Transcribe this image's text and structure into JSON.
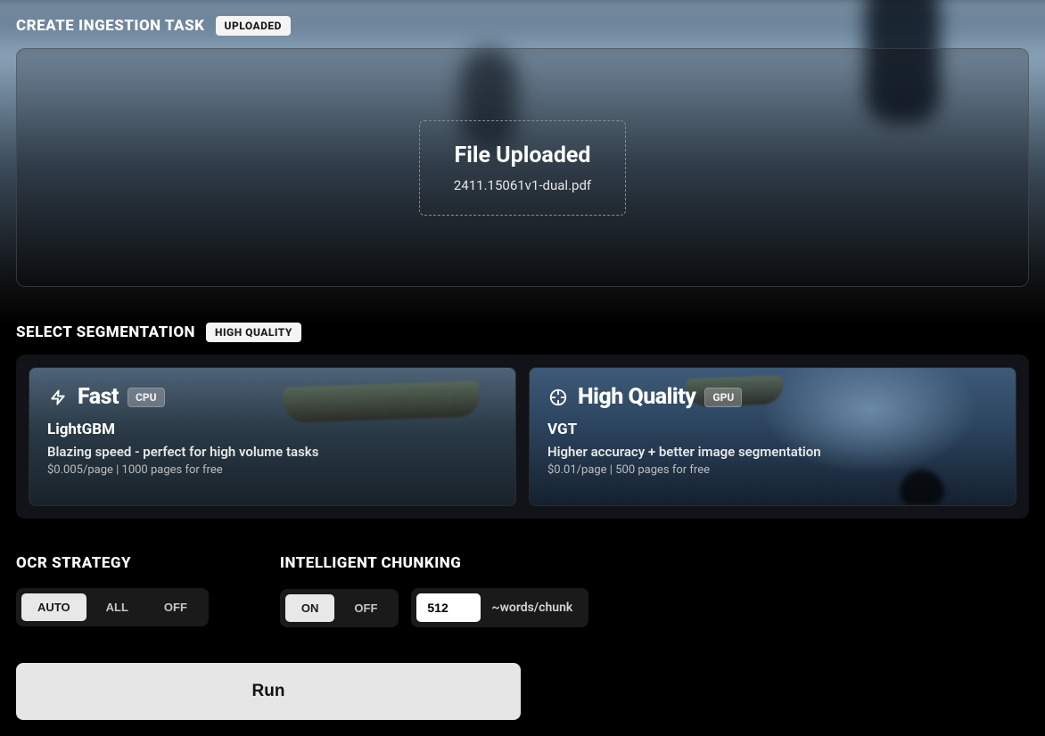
{
  "create": {
    "title": "CREATE INGESTION TASK",
    "badge": "UPLOADED",
    "upload_heading": "File Uploaded",
    "upload_filename": "2411.15061v1-dual.pdf"
  },
  "segmentation": {
    "title": "SELECT SEGMENTATION",
    "badge": "HIGH QUALITY",
    "cards": [
      {
        "id": "fast",
        "title": "Fast",
        "chip": "CPU",
        "subtitle": "LightGBM",
        "description": "Blazing speed - perfect for high volume tasks",
        "price": "$0.005/page | 1000 pages for free"
      },
      {
        "id": "hq",
        "title": "High Quality",
        "chip": "GPU",
        "subtitle": "VGT",
        "description": "Higher accuracy + better image segmentation",
        "price": "$0.01/page | 500 pages for free"
      }
    ]
  },
  "ocr": {
    "title": "OCR STRATEGY",
    "options": [
      "AUTO",
      "ALL",
      "OFF"
    ],
    "selected": "AUTO"
  },
  "chunking": {
    "title": "INTELLIGENT CHUNKING",
    "options": [
      "ON",
      "OFF"
    ],
    "selected": "ON",
    "value": "512",
    "suffix": "~words/chunk"
  },
  "run_label": "Run"
}
